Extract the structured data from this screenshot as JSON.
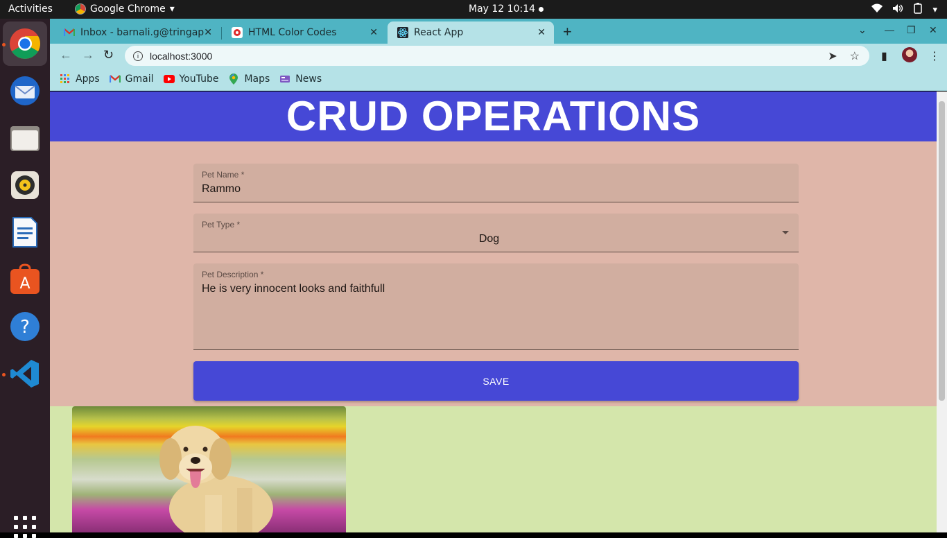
{
  "system": {
    "activities": "Activities",
    "app_menu": "Google Chrome",
    "clock": "May 12  10:14"
  },
  "tabs": [
    {
      "title": "Inbox - barnali.g@tringap",
      "icon": "gmail-icon"
    },
    {
      "title": "HTML Color Codes",
      "icon": "html-color-codes-icon"
    },
    {
      "title": "React App",
      "icon": "react-icon",
      "active": true
    }
  ],
  "address_bar": {
    "url": "localhost:3000"
  },
  "bookmarks": [
    {
      "label": "Apps",
      "icon": "apps-grid-icon"
    },
    {
      "label": "Gmail",
      "icon": "gmail-icon"
    },
    {
      "label": "YouTube",
      "icon": "youtube-icon"
    },
    {
      "label": "Maps",
      "icon": "maps-icon"
    },
    {
      "label": "News",
      "icon": "news-icon"
    }
  ],
  "page": {
    "heading": "CRUD OPERATIONS",
    "fields": {
      "pet_name": {
        "label": "Pet Name *",
        "value": "Rammo"
      },
      "pet_type": {
        "label": "Pet Type *",
        "value": "Dog"
      },
      "pet_description": {
        "label": "Pet Description *",
        "value": "He is very innocent looks and faithfull"
      }
    },
    "save_label": "SAVE"
  },
  "colors": {
    "header_bg": "#4648d6",
    "form_bg": "#dfb6a9",
    "list_bg": "#d4e6ab",
    "tab_strip": "#4fb4c3",
    "toolbar": "#b5e2e7"
  }
}
